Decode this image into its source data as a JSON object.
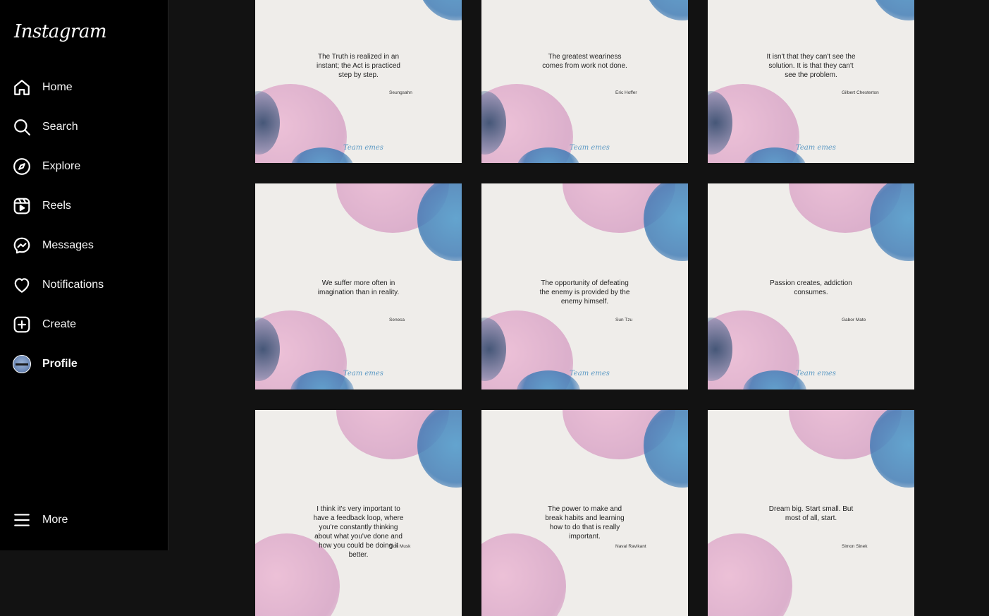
{
  "app": {
    "logo": "Instagram"
  },
  "sidebar": {
    "items": [
      {
        "label": "Home",
        "icon": "home-icon"
      },
      {
        "label": "Search",
        "icon": "search-icon"
      },
      {
        "label": "Explore",
        "icon": "compass-icon"
      },
      {
        "label": "Reels",
        "icon": "reels-icon"
      },
      {
        "label": "Messages",
        "icon": "messenger-icon"
      },
      {
        "label": "Notifications",
        "icon": "heart-icon"
      },
      {
        "label": "Create",
        "icon": "plus-square-icon"
      },
      {
        "label": "Profile",
        "icon": "avatar"
      }
    ],
    "more": {
      "label": "More",
      "icon": "menu-icon"
    }
  },
  "posts": [
    {
      "quote": "The Truth is realized in an instant; the Act is practiced step by step.",
      "author": "Seungsahn",
      "signature": "Team emes"
    },
    {
      "quote": "The greatest weariness comes from work not done.",
      "author": "Eric Hoffer",
      "signature": "Team emes"
    },
    {
      "quote": "It isn't that they can't see the solution. It is that they can't see the problem.",
      "author": "Gilbert Chesterton",
      "signature": "Team emes"
    },
    {
      "quote": "We suffer more often in imagination than in reality.",
      "author": "Seneca",
      "signature": "Team emes"
    },
    {
      "quote": "The opportunity of defeating the enemy is provided by the enemy himself.",
      "author": "Sun Tzu",
      "signature": "Team emes"
    },
    {
      "quote": "Passion creates, addiction consumes.",
      "author": "Gabor Mate",
      "signature": "Team emes"
    },
    {
      "quote": "I think it's very important to have a feedback loop, where you're constantly thinking about what you've done and how you could be doing it better.",
      "author": "Elon Musk",
      "signature": ""
    },
    {
      "quote": "The power to make and break habits and learning how to do that is really important.",
      "author": "Naval Ravikant",
      "signature": ""
    },
    {
      "quote": "Dream big. Start small. But most of all, start.",
      "author": "Simon Sinek",
      "signature": ""
    }
  ],
  "colors": {
    "sidebar_bg": "#000000",
    "page_bg": "#121212",
    "card_bg": "#efedea",
    "watercolor_pink": "#e7b9d2",
    "watercolor_blue": "#4f95c8",
    "watercolor_navy": "#344c6e"
  }
}
